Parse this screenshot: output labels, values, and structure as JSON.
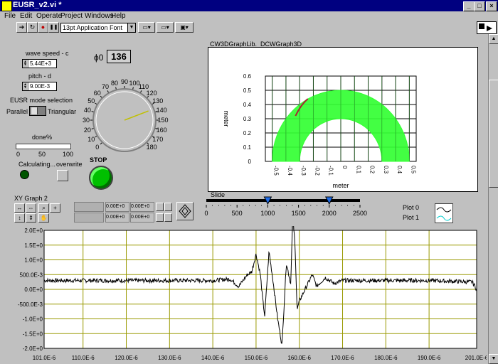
{
  "window": {
    "title": "EUSR_v2.vi *"
  },
  "menu": [
    "File",
    "Edit",
    "Operate",
    "Project",
    "Windows",
    "Help"
  ],
  "toolbar": {
    "font_select": "13pt Application Font"
  },
  "controls": {
    "wave_speed_label": "wave speed - c",
    "wave_speed_value": "5.44E+3",
    "pitch_label": "pitch - d",
    "pitch_value": "9.00E-3",
    "mode_label": "EUSR mode selection",
    "mode_left": "Parallel",
    "mode_right": "Triangular",
    "done_label": "done%",
    "done_ticks": [
      "0",
      "50",
      "100"
    ],
    "done_value": 0,
    "calc_label": "Calculating...",
    "overwrite_label": "overwrite",
    "phi0_label": "ϕ0",
    "phi0_value": "136",
    "stop_label": "STOP",
    "knob_ticks": [
      "0",
      "10",
      "20",
      "30",
      "40",
      "50",
      "60",
      "70",
      "80",
      "90",
      "100",
      "110",
      "120",
      "130",
      "140",
      "150",
      "160",
      "170",
      "180"
    ]
  },
  "graph3d": {
    "title": "CW3DGraphLib._DCWGraph3D",
    "xlabel": "meter",
    "ylabel": "meter",
    "yticks": [
      "0",
      "0.1",
      "0.2",
      "0.3",
      "0.4",
      "0.5",
      "0.6"
    ],
    "xticks": [
      "-0.5",
      "-0.4",
      "-0.3",
      "-0.2",
      "-0.1",
      "0",
      "0.1",
      "0.2",
      "0.3",
      "0.4",
      "0.5"
    ],
    "fill_color": "#33ff33"
  },
  "slide": {
    "label": "Slide",
    "ticks": [
      "0",
      "500",
      "1000",
      "1500",
      "2000",
      "2500"
    ],
    "thumbs": [
      1000,
      2000
    ],
    "max": 2500
  },
  "xy_graph": {
    "label": "XY Graph 2",
    "cursor_rows": [
      {
        "x": "0.00E+0",
        "y": "0.00E+0"
      },
      {
        "x": "0.00E+0",
        "y": "0.00E+0"
      }
    ],
    "legend": [
      "Plot 0",
      "Plot 1"
    ],
    "grid_color": "#999900",
    "trace_color": "#000000",
    "bg_color": "#ffffff"
  },
  "chart_data": {
    "type": "line",
    "title": "",
    "xlabel": "",
    "ylabel": "",
    "xlim": [
      0.000101,
      0.000201
    ],
    "ylim": [
      -2.0,
      2.0
    ],
    "xtick_labels": [
      "101.0E-6",
      "110.0E-6",
      "120.0E-6",
      "130.0E-6",
      "140.0E-6",
      "150.0E-6",
      "160.0E-6",
      "170.0E-6",
      "180.0E-6",
      "190.0E-6",
      "201.0E-6"
    ],
    "ytick_labels": [
      "2.0E+0",
      "1.5E+0",
      "1.0E+0",
      "500.0E-3",
      "0.0E+0",
      "-500.0E-3",
      "-1.0E+0",
      "-1.5E+0",
      "-2.0E+0"
    ],
    "series": [
      {
        "x": [
          101,
          120,
          140,
          144,
          146,
          148,
          149,
          150,
          151,
          151.5,
          152,
          153,
          154,
          155,
          156,
          157,
          158,
          158.5,
          159,
          159.5,
          160,
          161,
          162,
          163,
          164,
          166,
          168,
          170,
          180,
          190,
          200,
          201
        ],
        "values": [
          0.3,
          0.3,
          0.3,
          0.35,
          0.1,
          0.5,
          0.6,
          1.2,
          0.5,
          -0.3,
          -0.9,
          1.3,
          0.2,
          -1.0,
          -1.9,
          0.9,
          0.2,
          2.5,
          1.5,
          -0.7,
          -0.4,
          -0.1,
          0.2,
          0.5,
          0.1,
          0.4,
          0.2,
          0.3,
          0.3,
          0.3,
          0.25,
          0.0
        ]
      }
    ]
  }
}
